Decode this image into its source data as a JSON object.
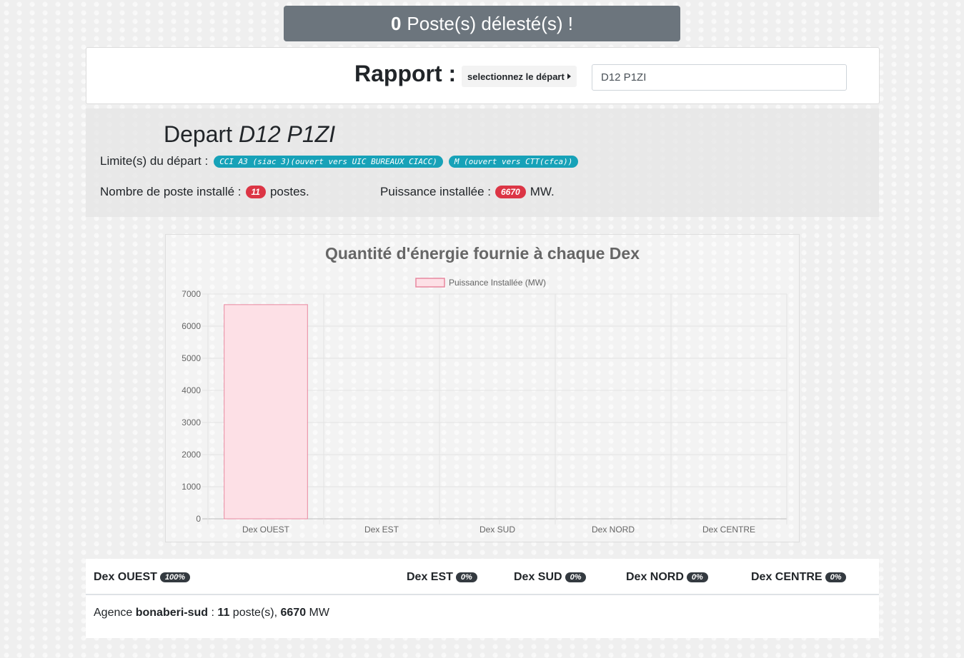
{
  "banner": {
    "count": "0",
    "text": "Poste(s) délesté(s) !"
  },
  "report": {
    "title": "Rapport :",
    "select_label": "selectionnez le départ",
    "depart_value": "D12 P1ZI"
  },
  "depart": {
    "prefix": "Depart",
    "name": "D12 P1ZI",
    "limits_label": "Limite(s) du départ :",
    "limits": [
      "CCI A3 (siac 3)(ouvert vers UIC BUREAUX CIACC)",
      "M (ouvert vers CTT(cfca))"
    ],
    "count_label": "Nombre de poste installé :",
    "count_value": "11",
    "count_suffix": "postes.",
    "power_label": "Puissance installée :",
    "power_value": "6670",
    "power_suffix": "MW."
  },
  "chart_data": {
    "type": "bar",
    "title": "Quantité d'énergie fournie à chaque Dex",
    "categories": [
      "Dex OUEST",
      "Dex EST",
      "Dex SUD",
      "Dex NORD",
      "Dex CENTRE"
    ],
    "series": [
      {
        "name": "Puissance Installée (MW)",
        "values": [
          6670,
          0,
          0,
          0,
          0
        ]
      }
    ],
    "xlabel": "",
    "ylabel": "",
    "ylim": [
      0,
      7000
    ],
    "yticks": [
      0,
      1000,
      2000,
      3000,
      4000,
      5000,
      6000,
      7000
    ],
    "grid": true,
    "legend": "top",
    "colors": {
      "bar_fill": "#fde0e6",
      "bar_stroke": "#e8889f",
      "title": "#666666"
    }
  },
  "dex_summary": {
    "items": [
      {
        "name": "Dex OUEST",
        "pct": "100%"
      },
      {
        "name": "Dex EST",
        "pct": "0%"
      },
      {
        "name": "Dex SUD",
        "pct": "0%"
      },
      {
        "name": "Dex NORD",
        "pct": "0%"
      },
      {
        "name": "Dex CENTRE",
        "pct": "0%"
      }
    ],
    "agency": {
      "prefix": "Agence",
      "name": "bonaberi-sud",
      "sep": ":",
      "count": "11",
      "count_suffix": "poste(s),",
      "power": "6670",
      "unit": "MW"
    }
  },
  "colors": {
    "banner": "#6c757d",
    "info_pill": "#17a2b8",
    "danger_pill": "#dc3545",
    "dark_pill": "#343a40"
  }
}
